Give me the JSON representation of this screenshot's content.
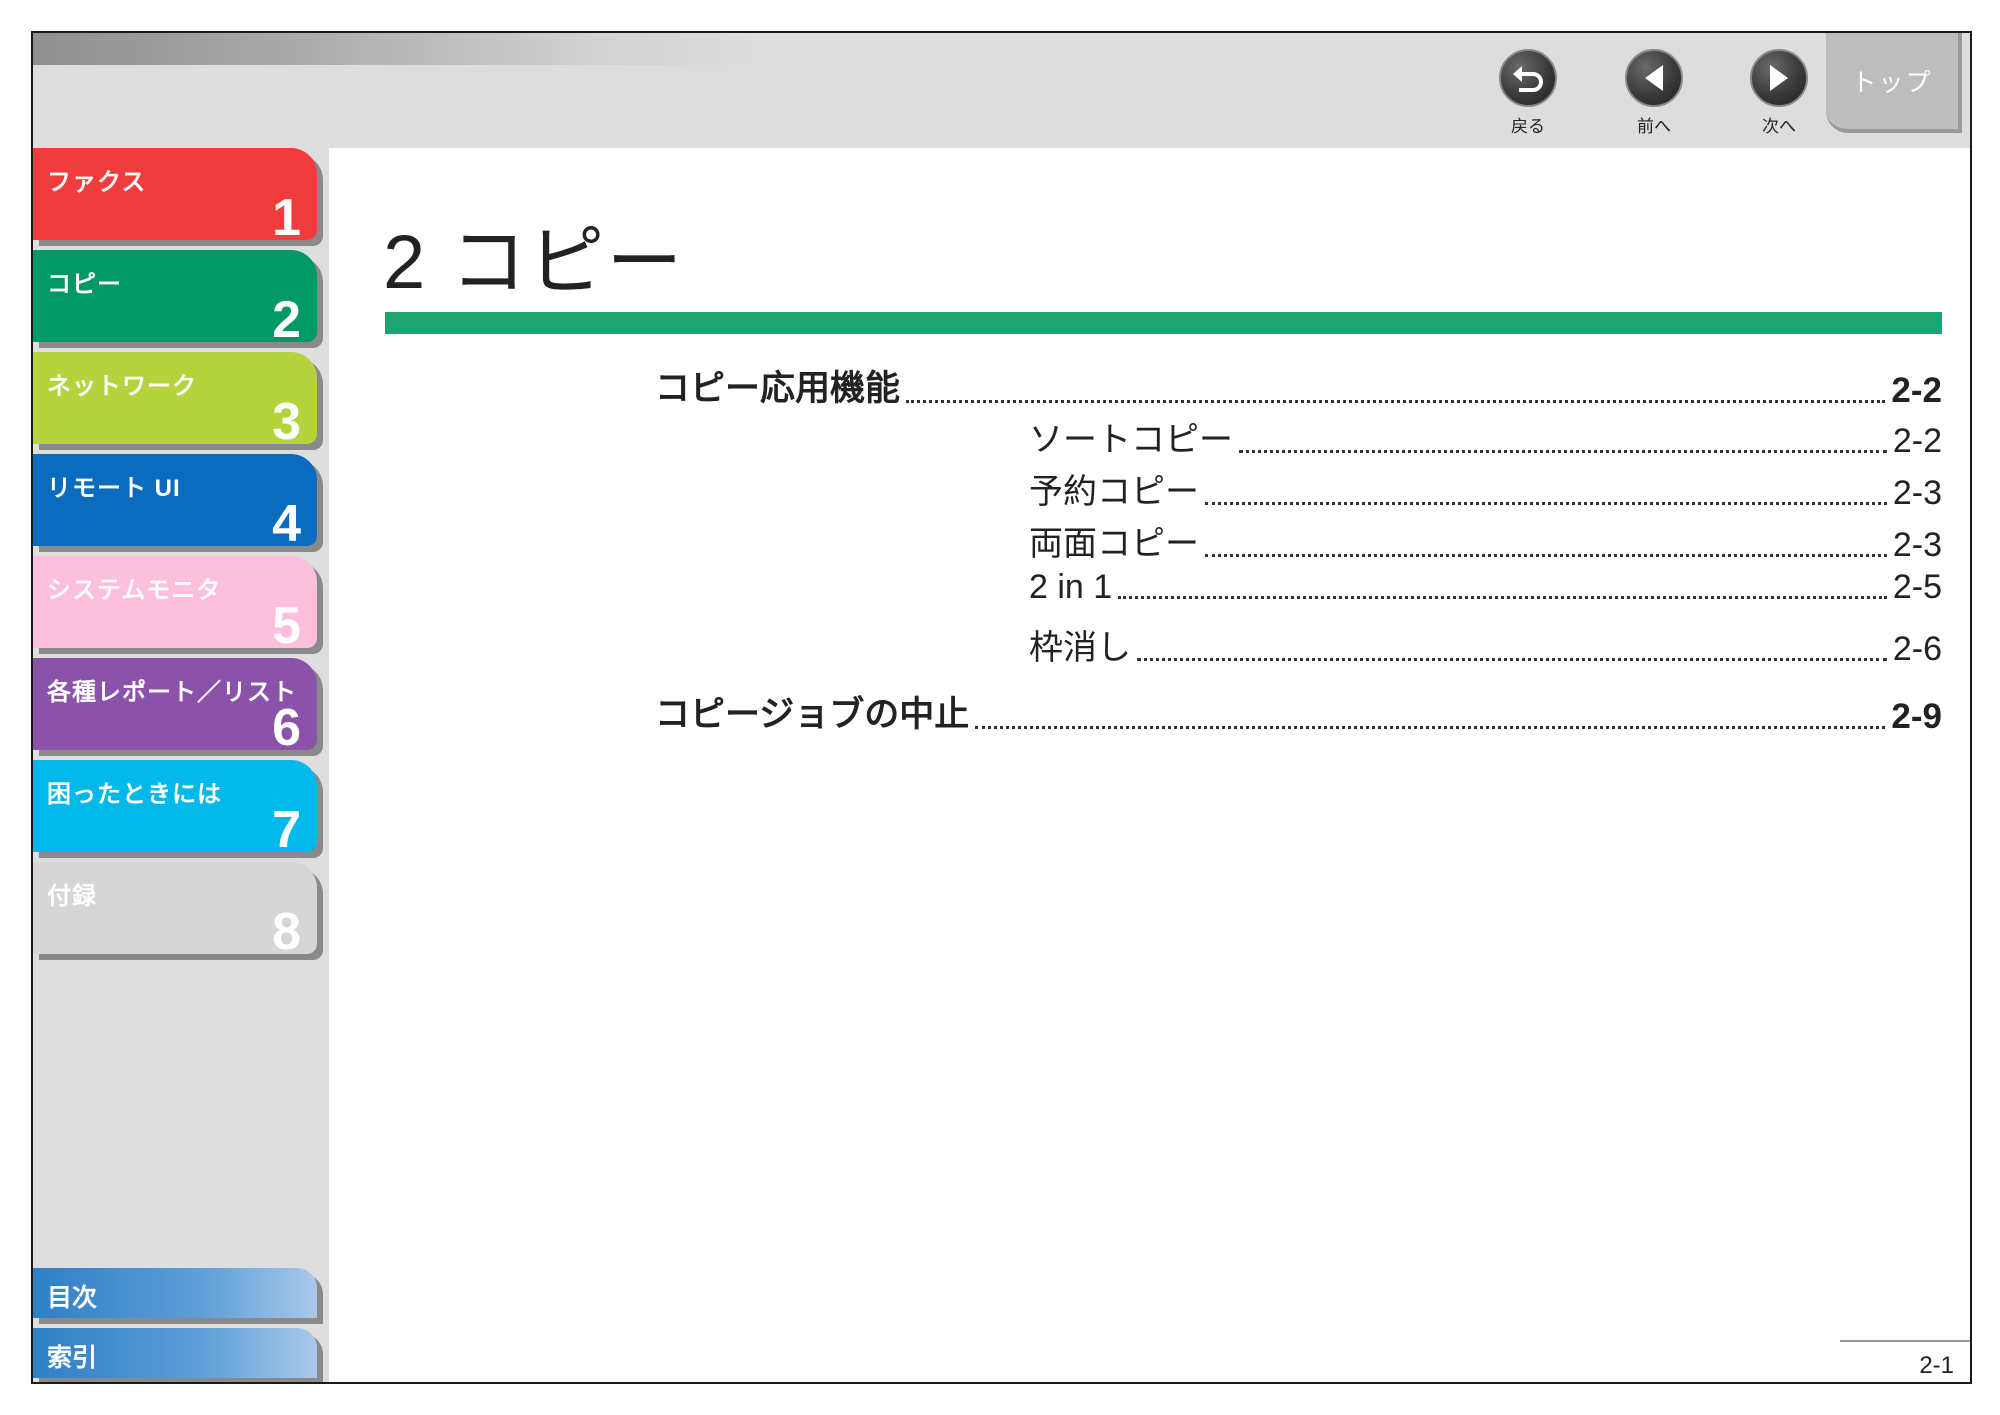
{
  "header": {
    "nav": [
      {
        "label": "戻る",
        "icon": "back-arrow-icon"
      },
      {
        "label": "前へ",
        "icon": "triangle-left-icon"
      },
      {
        "label": "次へ",
        "icon": "triangle-right-icon"
      }
    ],
    "top_label": "トップ"
  },
  "sidebar": {
    "tabs": [
      {
        "label": "ファクス",
        "number": "1",
        "color": "#f03c3c"
      },
      {
        "label": "コピー",
        "number": "2",
        "color": "#009966"
      },
      {
        "label": "ネットワーク",
        "number": "3",
        "color": "#b5d33d"
      },
      {
        "label": "リモート UI",
        "number": "4",
        "color": "#0b6cbf"
      },
      {
        "label": "システムモニタ",
        "number": "5",
        "color": "#fcbfdc"
      },
      {
        "label": "各種レポート／リスト",
        "number": "6",
        "color": "#8a52a8"
      },
      {
        "label": "困ったときには",
        "number": "7",
        "color": "#00b8ea"
      },
      {
        "label": "付録",
        "number": "8",
        "color": "#d6d6d6"
      }
    ],
    "bottom_tabs": [
      {
        "label": "目次"
      },
      {
        "label": "索引"
      }
    ]
  },
  "main": {
    "title": "2 コピー",
    "accent_color": "#1ea572",
    "toc": [
      {
        "label": "コピー応用機能",
        "page": "2-2",
        "level": 1
      },
      {
        "label": "ソートコピー",
        "page": "2-2",
        "level": 2
      },
      {
        "label": "予約コピー",
        "page": "2-3",
        "level": 2
      },
      {
        "label": "両面コピー",
        "page": "2-3",
        "level": 2
      },
      {
        "label": "2 in 1",
        "page": "2-5",
        "level": 2
      },
      {
        "label": "枠消し",
        "page": "2-6",
        "level": 2
      },
      {
        "label": "コピージョブの中止",
        "page": "2-9",
        "level": 1
      }
    ]
  },
  "footer": {
    "page_number": "2-1"
  }
}
